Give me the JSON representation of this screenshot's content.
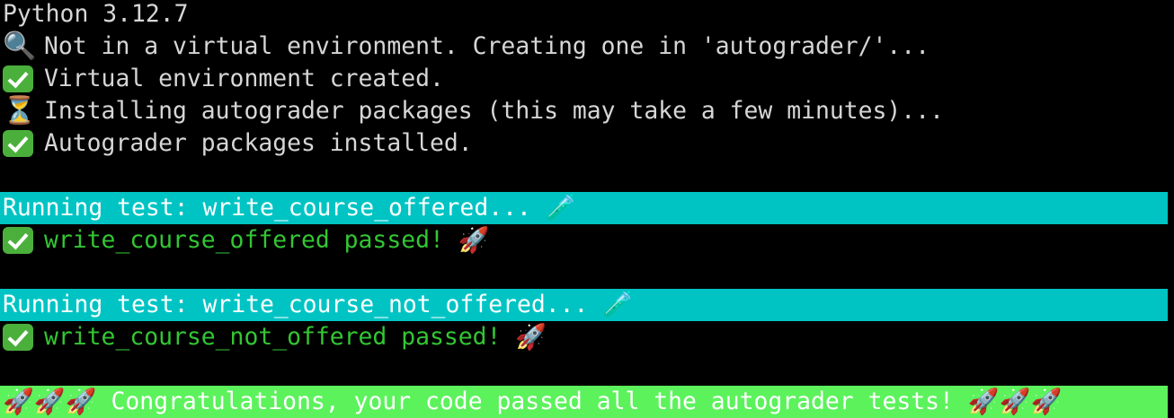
{
  "lines": {
    "python_version": "Python 3.12.7",
    "venv_search_icon": "🔍",
    "venv_search": "Not in a virtual environment. Creating one in 'autograder/'...",
    "venv_created": "Virtual environment created.",
    "installing_icon": "⏳",
    "installing": "Installing autograder packages (this may take a few minutes)...",
    "installed": "Autograder packages installed."
  },
  "tests": [
    {
      "running": "Running test: write_course_offered... ",
      "running_icon": "🧪",
      "passed": "write_course_offered passed! ",
      "passed_icon": "🚀"
    },
    {
      "running": "Running test: write_course_not_offered... ",
      "running_icon": "🧪",
      "passed": "write_course_not_offered passed! ",
      "passed_icon": "🚀"
    }
  ],
  "summary": {
    "rockets_left": "🚀🚀🚀",
    "message": " Congratulations, your code passed all the autograder tests! ",
    "rockets_right": "🚀🚀🚀"
  },
  "colors": {
    "background": "#000000",
    "text": "#d6d6d6",
    "running_band": "#00c4c4",
    "pass_text": "#33c633",
    "congrats_band": "#5cf25c",
    "check_box": "#4ab03b"
  }
}
